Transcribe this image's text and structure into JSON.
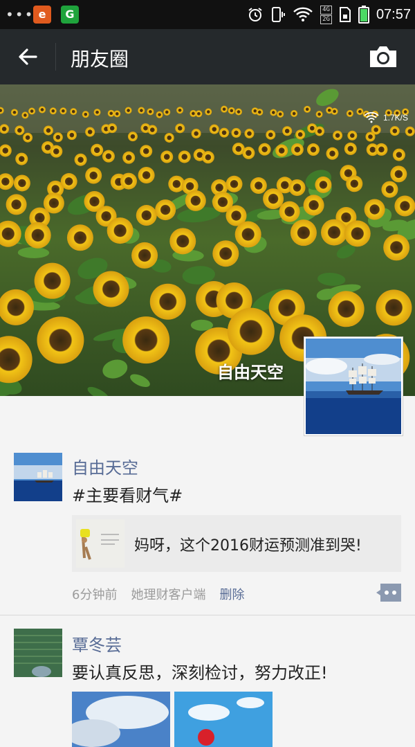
{
  "status_bar": {
    "time": "07:57",
    "network": [
      "4G",
      "2G"
    ],
    "app1_letter": "e",
    "app2_letter": "G",
    "icons": [
      "overflow-dots-icon",
      "alarm-icon",
      "phone-vibrate-icon",
      "wifi-icon",
      "signal-icon",
      "sim-icon",
      "battery-icon"
    ]
  },
  "header": {
    "title": "朋友圈"
  },
  "cover": {
    "user_name": "自由天空",
    "net_speed": "1.7K/S"
  },
  "posts": [
    {
      "author": "自由天空",
      "text": "#主要看财气#",
      "link_title": "妈呀，这个2016财运预测准到哭!",
      "time": "6分钟前",
      "source": "她理财客户端",
      "delete_label": "删除"
    },
    {
      "author": "覃冬芸",
      "text": "要认真反思，深刻检讨，努力改正!"
    }
  ],
  "colors": {
    "title_bar": "#25292c",
    "author_link": "#576b95",
    "background": "#f4f4f4"
  }
}
